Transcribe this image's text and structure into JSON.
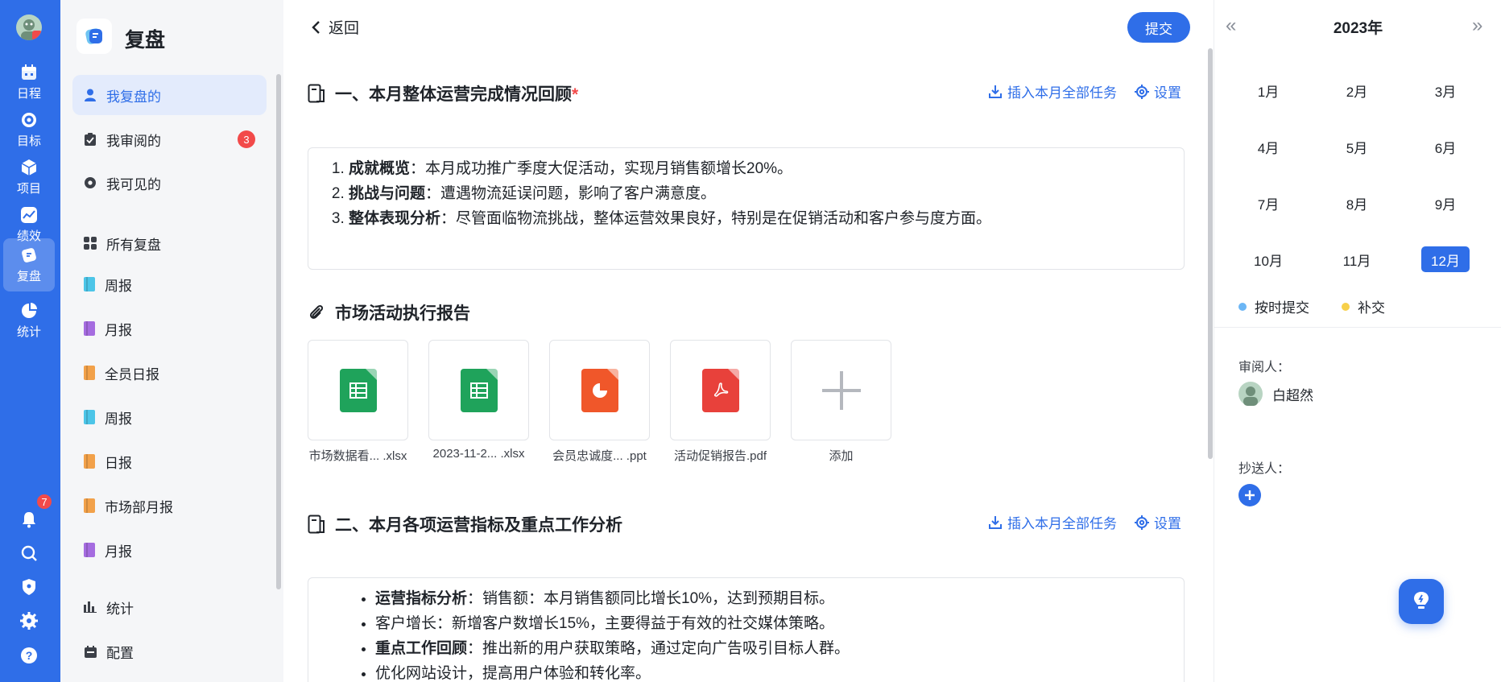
{
  "rail": {
    "items": [
      {
        "label": "日程",
        "icon": "calendar-icon"
      },
      {
        "label": "目标",
        "icon": "target-icon"
      },
      {
        "label": "项目",
        "icon": "cube-icon"
      },
      {
        "label": "绩效",
        "icon": "chart-icon"
      },
      {
        "label": "复盘",
        "icon": "review-icon",
        "active": true
      },
      {
        "label": "统计",
        "icon": "pie-icon"
      }
    ],
    "notification_count": "7"
  },
  "sidebar": {
    "title": "复盘",
    "items": [
      {
        "label": "我复盘的",
        "icon": "user-icon",
        "active": true
      },
      {
        "label": "我审阅的",
        "icon": "clipboard-icon",
        "count": "3"
      },
      {
        "label": "我可见的",
        "icon": "eye-icon"
      },
      {
        "label": "所有复盘",
        "icon": "grid-icon"
      },
      {
        "label": "周报",
        "color": "#4cc5e8"
      },
      {
        "label": "月报",
        "color": "#a56ce0"
      },
      {
        "label": "全员日报",
        "color": "#f2a14a"
      },
      {
        "label": "周报",
        "color": "#4cc5e8"
      },
      {
        "label": "日报",
        "color": "#f2a14a"
      },
      {
        "label": "市场部月报",
        "color": "#f2a14a"
      },
      {
        "label": "月报",
        "color": "#a56ce0"
      }
    ],
    "footer": [
      {
        "label": "统计",
        "icon": "bar-chart-icon"
      },
      {
        "label": "配置",
        "icon": "calendar-config-icon"
      }
    ]
  },
  "main": {
    "back_label": "返回",
    "submit_label": "提交",
    "section1": {
      "title": "一、本月整体运营完成情况回顾",
      "required_mark": "*",
      "insert_label": "插入本月全部任务",
      "settings_label": "设置",
      "items": [
        {
          "bold": "成就概览",
          "text": "：本月成功推广季度大促活动，实现月销售额增长20%。"
        },
        {
          "bold": "挑战与问题",
          "text": "：遭遇物流延误问题，影响了客户满意度。"
        },
        {
          "bold": "整体表现分析",
          "text": "：尽管面临物流挑战，整体运营效果良好，特别是在促销活动和客户参与度方面。"
        }
      ]
    },
    "attachments": {
      "title": "市场活动执行报告",
      "files": [
        {
          "name": "市场数据看... .xlsx",
          "type": "xlsx",
          "color": "#1fa35b"
        },
        {
          "name": "2023-11-2... .xlsx",
          "type": "xlsx",
          "color": "#1fa35b"
        },
        {
          "name": "会员忠诚度... .ppt",
          "type": "ppt",
          "color": "#f0572a"
        },
        {
          "name": "活动促销报告.pdf",
          "type": "pdf",
          "color": "#e8413b"
        }
      ],
      "add_label": "添加"
    },
    "section2": {
      "title": "二、本月各项运营指标及重点工作分析",
      "insert_label": "插入本月全部任务",
      "settings_label": "设置",
      "items": [
        {
          "bold": "运营指标分析",
          "text": "：销售额：本月销售额同比增长10%，达到预期目标。"
        },
        {
          "bold": "",
          "text": "客户增长：新增客户数增长15%，主要得益于有效的社交媒体策略。"
        },
        {
          "bold": "重点工作回顾",
          "text": "：推出新的用户获取策略，通过定向广告吸引目标人群。"
        },
        {
          "bold": "",
          "text": "优化网站设计，提高用户体验和转化率。"
        }
      ]
    }
  },
  "calendar": {
    "year": "2023年",
    "prev": "«",
    "next": "»",
    "months": [
      "1月",
      "2月",
      "3月",
      "4月",
      "5月",
      "6月",
      "7月",
      "8月",
      "9月",
      "10月",
      "11月",
      "12月"
    ],
    "selected_month": "12月",
    "legend": [
      {
        "label": "按时提交",
        "color": "#6cb6f5"
      },
      {
        "label": "补交",
        "color": "#f7d04a"
      }
    ],
    "reviewer_label": "审阅人：",
    "reviewer_name": "白超然",
    "cc_label": "抄送人："
  }
}
